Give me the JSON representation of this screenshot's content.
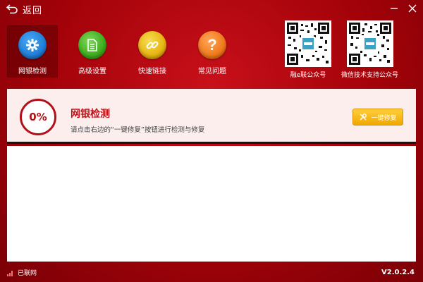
{
  "titlebar": {
    "back_label": "返回"
  },
  "toolbar": {
    "items": [
      {
        "label": "网银检测",
        "icon": "gear-icon",
        "color": "#1f7fd8",
        "active": true
      },
      {
        "label": "高级设置",
        "icon": "document-icon",
        "color": "#3cad1d",
        "active": false
      },
      {
        "label": "快速链接",
        "icon": "link-icon",
        "color": "#e6b410",
        "active": false
      },
      {
        "label": "常见问题",
        "icon": "question-icon",
        "color": "#f07a1a",
        "active": false
      }
    ]
  },
  "qr_codes": [
    {
      "caption": "融e联公众号"
    },
    {
      "caption": "微信技术支持公众号"
    }
  ],
  "status_panel": {
    "percent": "0%",
    "title": "网银检测",
    "description": "请点击右边的“一键修复”按钮进行检测与修复",
    "fix_button_label": "一键修复"
  },
  "statusbar": {
    "connection": "已联网",
    "version": "V2.0.2.4"
  },
  "colors": {
    "background": "#a8050c",
    "accent_red": "#c0141b",
    "button_yellow": "#f0a800",
    "panel_bg": "#fdeeee"
  }
}
